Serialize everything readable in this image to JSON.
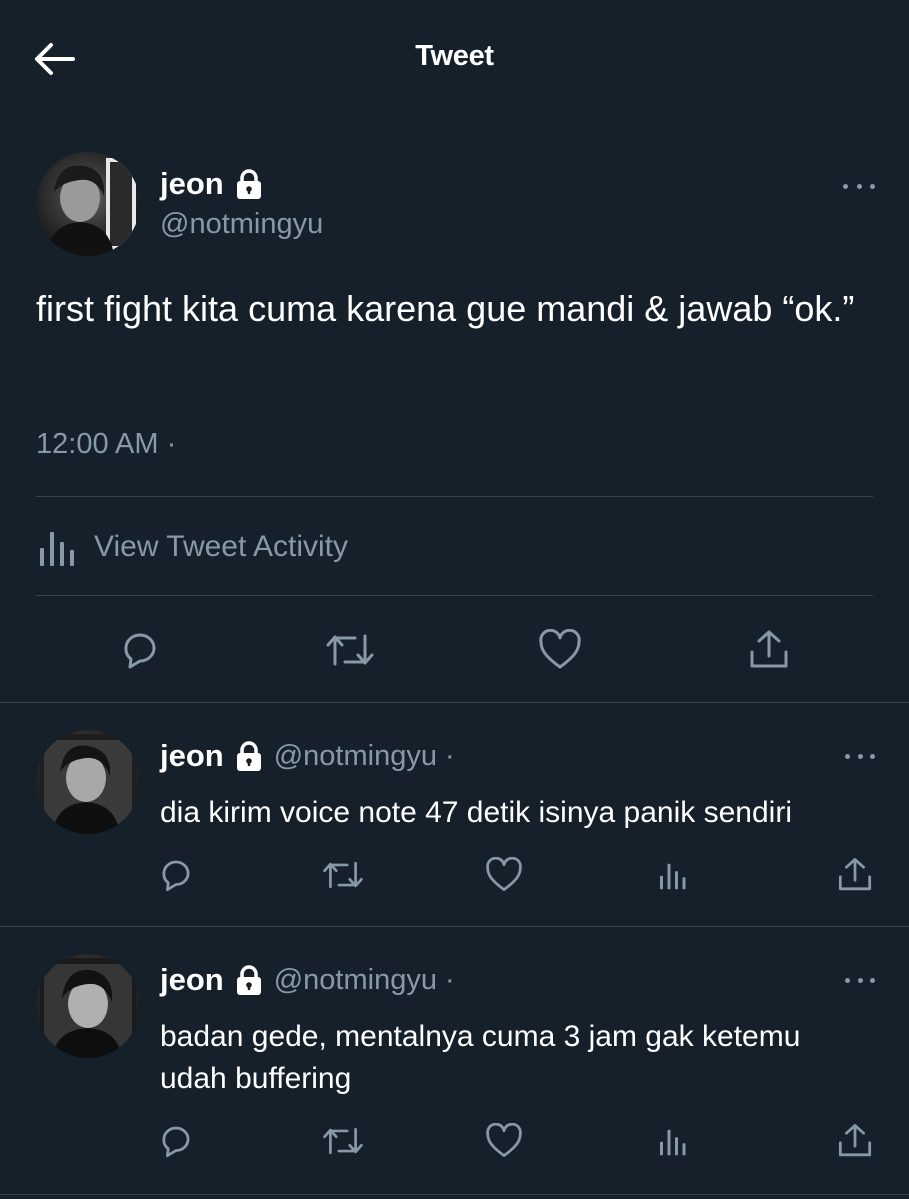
{
  "header": {
    "title": "Tweet",
    "back_icon": "arrow-left-icon"
  },
  "main_tweet": {
    "display_name": "jeon",
    "handle": "@notmingyu",
    "text": "first fight kita cuma karena gue mandi & jawab “ok.”",
    "timestamp": "12:00 AM ·",
    "activity_label": "View Tweet Activity",
    "actions": [
      "reply-icon",
      "retweet-icon",
      "like-icon",
      "share-icon"
    ]
  },
  "replies": [
    {
      "display_name": "jeon",
      "handle": "@notmingyu ·",
      "text": "dia kirim voice note 47 detik isinya panik sendiri"
    },
    {
      "display_name": "jeon",
      "handle": "@notmingyu ·",
      "text": "badan gede, mentalnya cuma 3 jam gak ketemu udah buffering"
    }
  ],
  "colors": {
    "background": "#15202b",
    "text_primary": "#ffffff",
    "text_secondary": "#8899a6",
    "divider": "#38444d"
  }
}
